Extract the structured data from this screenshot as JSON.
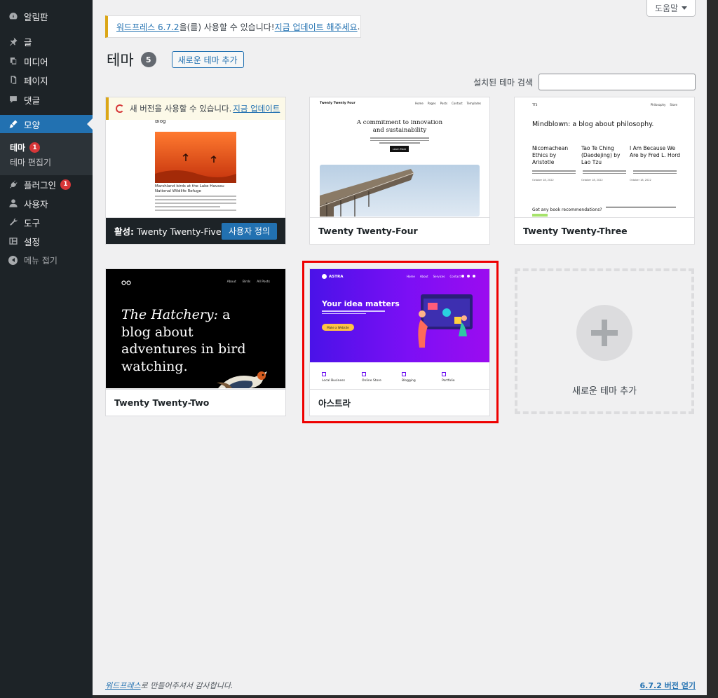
{
  "sidebar": {
    "items": [
      {
        "label": "알림판",
        "icon": "dashboard-icon"
      },
      {
        "label": "글",
        "icon": "pin-icon"
      },
      {
        "label": "미디어",
        "icon": "media-icon"
      },
      {
        "label": "페이지",
        "icon": "page-icon"
      },
      {
        "label": "댓글",
        "icon": "comment-icon"
      },
      {
        "label": "모양",
        "icon": "appearance-icon"
      },
      {
        "label": "플러그인",
        "icon": "plugin-icon",
        "badge": "1"
      },
      {
        "label": "사용자",
        "icon": "user-icon"
      },
      {
        "label": "도구",
        "icon": "tool-icon"
      },
      {
        "label": "설정",
        "icon": "settings-icon"
      }
    ],
    "submenu": [
      {
        "label": "테마",
        "badge": "1"
      },
      {
        "label": "테마 편집기"
      }
    ],
    "collapse": "메뉴 접기"
  },
  "header": {
    "help": "도움말",
    "notice_link": "워드프레스 6.7.2",
    "notice_text": "을(를) 사용할 수 있습니다! ",
    "notice_update": "지금 업데이트 해주세요",
    "notice_end": ".",
    "title": "테마",
    "count": "5",
    "add_new": "새로운 테마 추가",
    "search_label": "설치된 테마 검색",
    "search_placeholder": ""
  },
  "themes": [
    {
      "name": "Twenty Twenty-Five",
      "active_prefix": "활성:",
      "customize": "사용자 정의",
      "update_text": "새 버전을 사용할 수 있습니다. ",
      "update_link": "지금 업데이트",
      "shot": {
        "heading": "Blog",
        "caption": "Marshland birds at the Lake Havasu National Wildlife Refuge"
      }
    },
    {
      "name": "Twenty Twenty-Four",
      "shot": {
        "site": "Twenty Twenty Four",
        "nav": [
          "Home",
          "Pages",
          "Posts",
          "Contact",
          "Templates"
        ],
        "headline": "A commitment to innovation and sustainability",
        "button": "Learn More"
      }
    },
    {
      "name": "Twenty Twenty-Three",
      "shot": {
        "site": "TT3",
        "nav": [
          "Philosophy",
          "Store"
        ],
        "headline": "Mindblown: a blog about philosophy.",
        "posts": [
          "Nicomachean Ethics by Aristotle",
          "Tao Te Ching (Daodejing) by Lao Tzu",
          "I Am Because We Are by Fred L. Hord"
        ],
        "dates": [
          "October 18, 2022",
          "October 18, 2022",
          "October 18, 2022"
        ],
        "cta": "Got any book recommendations?"
      }
    },
    {
      "name": "Twenty Twenty-Two",
      "shot": {
        "nav": [
          "About",
          "Birds",
          "All Posts"
        ],
        "headline_em": "The Hatchery:",
        "headline": " a blog about adventures in bird watching."
      }
    },
    {
      "name": "아스트라",
      "shot": {
        "logo": "ASTRA",
        "nav": [
          "Home",
          "About",
          "Services",
          "Contact"
        ],
        "headline": "Your idea matters",
        "button": "Make a Website",
        "features": [
          "Local Business",
          "Online Store",
          "Blogging",
          "Portfolio"
        ]
      }
    }
  ],
  "add_new_card": "새로운 테마 추가",
  "footer": {
    "link": "워드프레스",
    "text": "로 만들어주셔서 감사합니다.",
    "version": "6.7.2 버전 얻기"
  },
  "colors": {
    "accent": "#2271b1",
    "sidebar": "#1d2327",
    "highlight": "#e00000",
    "astra_purple": "#6a0df0"
  }
}
